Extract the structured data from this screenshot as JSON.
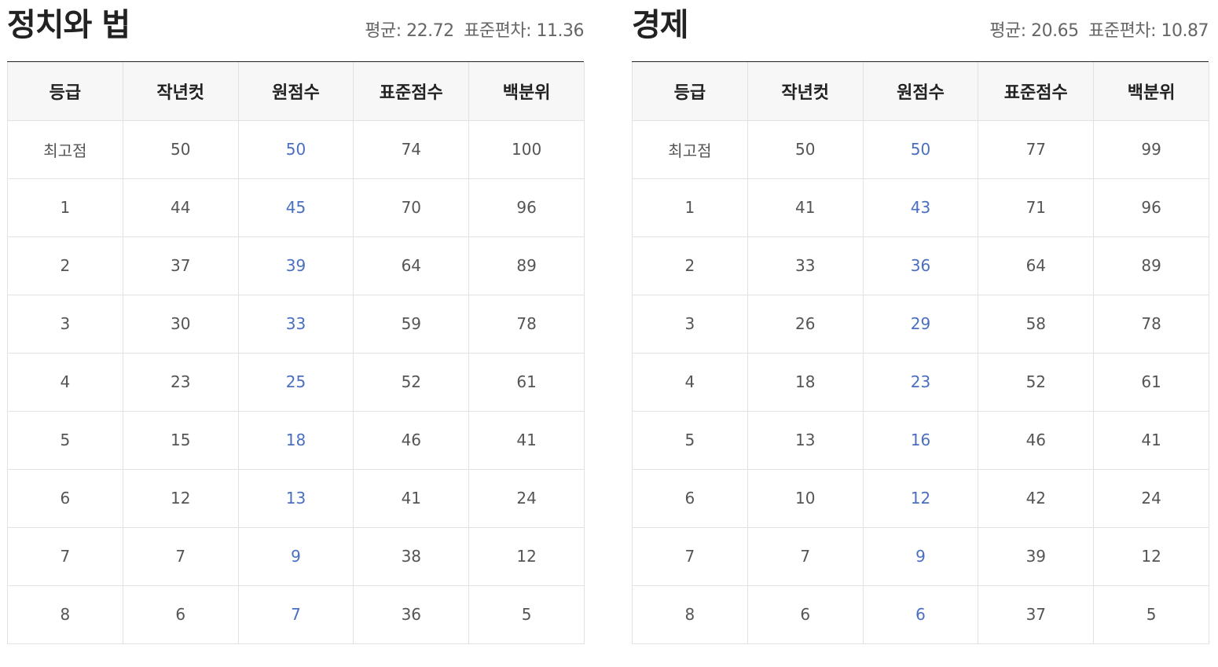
{
  "headers": [
    "등급",
    "작년컷",
    "원점수",
    "표준점수",
    "백분위"
  ],
  "panels": [
    {
      "title": "정치와 법",
      "stats": {
        "mean_label": "평균:",
        "mean": "22.72",
        "std_label": "표준편차:",
        "std": "11.36"
      },
      "rows": [
        {
          "grade": "최고점",
          "last_year_cut": "50",
          "raw": "50",
          "standard": "74",
          "percentile": "100"
        },
        {
          "grade": "1",
          "last_year_cut": "44",
          "raw": "45",
          "standard": "70",
          "percentile": "96"
        },
        {
          "grade": "2",
          "last_year_cut": "37",
          "raw": "39",
          "standard": "64",
          "percentile": "89"
        },
        {
          "grade": "3",
          "last_year_cut": "30",
          "raw": "33",
          "standard": "59",
          "percentile": "78"
        },
        {
          "grade": "4",
          "last_year_cut": "23",
          "raw": "25",
          "standard": "52",
          "percentile": "61"
        },
        {
          "grade": "5",
          "last_year_cut": "15",
          "raw": "18",
          "standard": "46",
          "percentile": "41"
        },
        {
          "grade": "6",
          "last_year_cut": "12",
          "raw": "13",
          "standard": "41",
          "percentile": "24"
        },
        {
          "grade": "7",
          "last_year_cut": "7",
          "raw": "9",
          "standard": "38",
          "percentile": "12"
        },
        {
          "grade": "8",
          "last_year_cut": "6",
          "raw": "7",
          "standard": "36",
          "percentile": "5"
        }
      ]
    },
    {
      "title": "경제",
      "stats": {
        "mean_label": "평균:",
        "mean": "20.65",
        "std_label": "표준편차:",
        "std": "10.87"
      },
      "rows": [
        {
          "grade": "최고점",
          "last_year_cut": "50",
          "raw": "50",
          "standard": "77",
          "percentile": "99"
        },
        {
          "grade": "1",
          "last_year_cut": "41",
          "raw": "43",
          "standard": "71",
          "percentile": "96"
        },
        {
          "grade": "2",
          "last_year_cut": "33",
          "raw": "36",
          "standard": "64",
          "percentile": "89"
        },
        {
          "grade": "3",
          "last_year_cut": "26",
          "raw": "29",
          "standard": "58",
          "percentile": "78"
        },
        {
          "grade": "4",
          "last_year_cut": "18",
          "raw": "23",
          "standard": "52",
          "percentile": "61"
        },
        {
          "grade": "5",
          "last_year_cut": "13",
          "raw": "16",
          "standard": "46",
          "percentile": "41"
        },
        {
          "grade": "6",
          "last_year_cut": "10",
          "raw": "12",
          "standard": "42",
          "percentile": "24"
        },
        {
          "grade": "7",
          "last_year_cut": "7",
          "raw": "9",
          "standard": "39",
          "percentile": "12"
        },
        {
          "grade": "8",
          "last_year_cut": "6",
          "raw": "6",
          "standard": "37",
          "percentile": "5"
        }
      ]
    }
  ],
  "colors": {
    "title": "#222222",
    "raw_score": "#4a6fc0",
    "header_bg": "#f7f7f7",
    "border": "#e2e2e2"
  }
}
